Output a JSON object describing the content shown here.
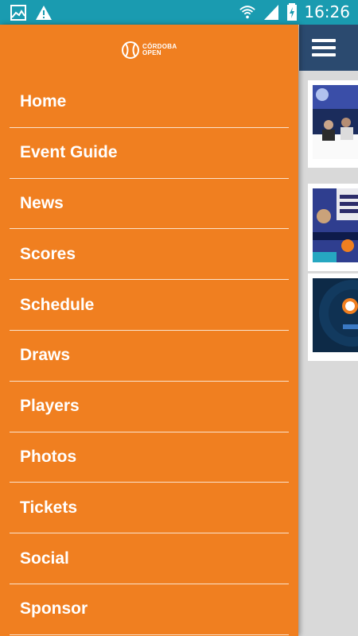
{
  "status_bar": {
    "time": "16:26",
    "left_icons": [
      "gallery-icon",
      "warning-icon"
    ],
    "right_icons": [
      "wifi-icon",
      "signal-icon",
      "battery-charging-icon"
    ]
  },
  "drawer": {
    "logo": {
      "line1": "CÓRDOBA",
      "line2": "OPEN"
    },
    "items": [
      {
        "label": "Home"
      },
      {
        "label": "Event Guide"
      },
      {
        "label": "News"
      },
      {
        "label": "Scores"
      },
      {
        "label": "Schedule"
      },
      {
        "label": "Draws"
      },
      {
        "label": "Players"
      },
      {
        "label": "Photos"
      },
      {
        "label": "Tickets"
      },
      {
        "label": "Social"
      },
      {
        "label": "Sponsor"
      }
    ]
  },
  "background": {
    "appbar_icon": "menu-icon",
    "feed_images": [
      "press-conference-photo",
      "promo-banner-photo",
      "atp-logo-photo"
    ]
  },
  "colors": {
    "status_bar": "#1a9bb0",
    "drawer": "#f07f20",
    "appbar": "#2b4a6f",
    "background": "#d9d9d9"
  }
}
